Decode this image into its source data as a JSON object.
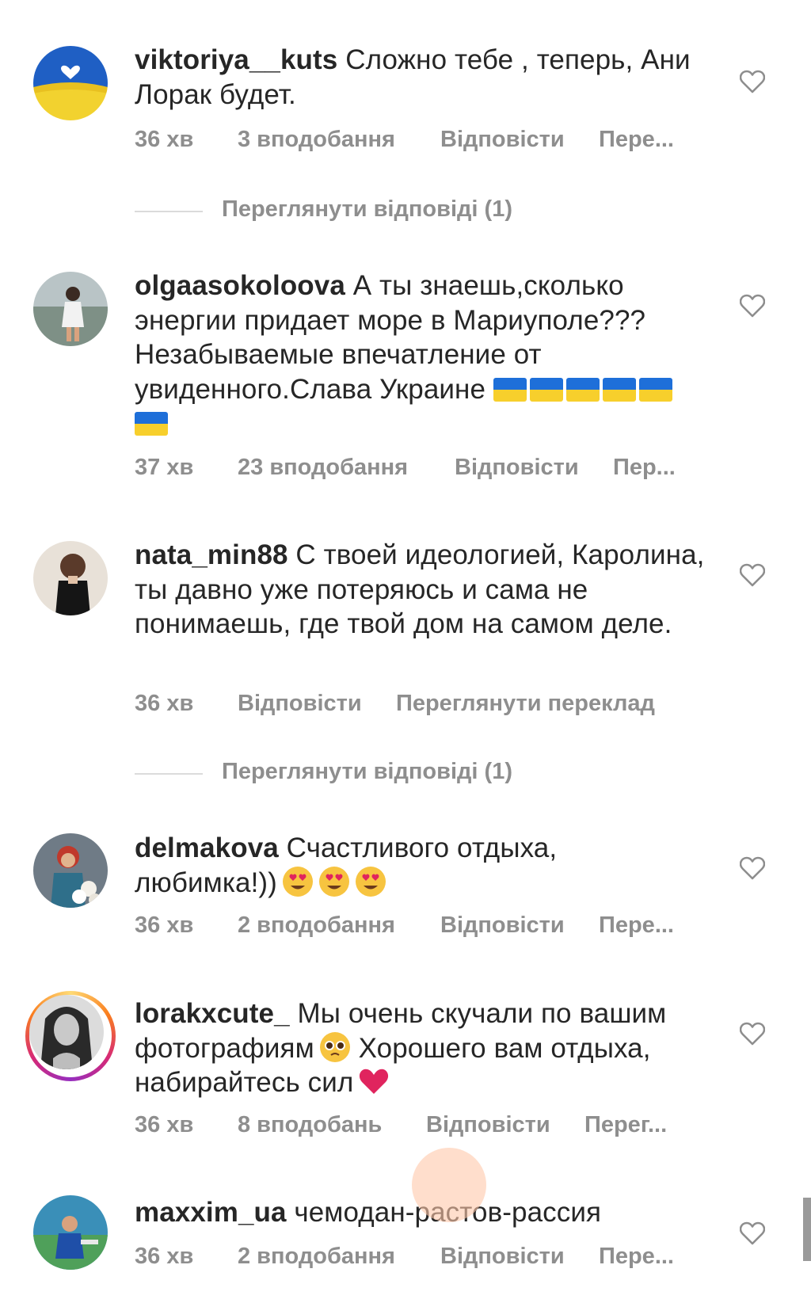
{
  "colors": {
    "text": "#262626",
    "muted": "#8e8e8e",
    "divider": "#dbdbdb",
    "heart_stroke": "#8e8e8e"
  },
  "comments": [
    {
      "username": "viktoriya__kuts",
      "text": "Сложно тебе , теперь, Ани Лорак будет.",
      "time": "36 хв",
      "likes": "3 вподобання",
      "reply": "Відповісти",
      "translate": "Пере...",
      "avatar": "ukrainian-flag-heart-avatar",
      "view_replies": "Переглянути відповіді (1)"
    },
    {
      "username": "olgaasokoloova",
      "text": "А ты знаешь,сколько энергии придает  море в Мариуполе??? Незабываемые впечатление от увиденного.Слава Украине",
      "time": "37 хв",
      "likes": "23 вподобання",
      "reply": "Відповісти",
      "translate": "Пер...",
      "avatar": "beach-woman-avatar",
      "flags": 6
    },
    {
      "username": "nata_min88",
      "text": "С твоей идеологией, Каролина, ты давно уже потеряюсь и сама не понимаешь, где твой дом на самом деле.",
      "time": "36 хв",
      "reply": "Відповісти",
      "translate": "Переглянути переклад",
      "avatar": "woman-in-black-avatar",
      "view_replies": "Переглянути відповіді (1)"
    },
    {
      "username": "delmakova",
      "text": "Счастливого отдыха, любимка!))",
      "time": "36 хв",
      "likes": "2 вподобання",
      "reply": "Відповісти",
      "translate": "Пере...",
      "avatar": "woman-with-flowers-avatar",
      "emoji": "heart-eyes-emoji"
    },
    {
      "username": "lorakxcute_",
      "text_a": "Мы очень скучали по вашим фотографиям",
      "text_b": " Хорошего вам отдыха, набирайтесь сил",
      "time": "36 хв",
      "likes": "8 вподобань",
      "reply": "Відповісти",
      "translate": "Перег...",
      "avatar": "portrait-woman-story-avatar",
      "emoji_a": "pleading-face-emoji",
      "emoji_b": "red-heart-emoji"
    },
    {
      "username": "maxxim_ua",
      "text": "чемодан-растов-рассия",
      "time": "36 хв",
      "likes": "2 вподобання",
      "reply": "Відповісти",
      "translate": "Пере...",
      "avatar": "man-outdoors-avatar"
    }
  ]
}
